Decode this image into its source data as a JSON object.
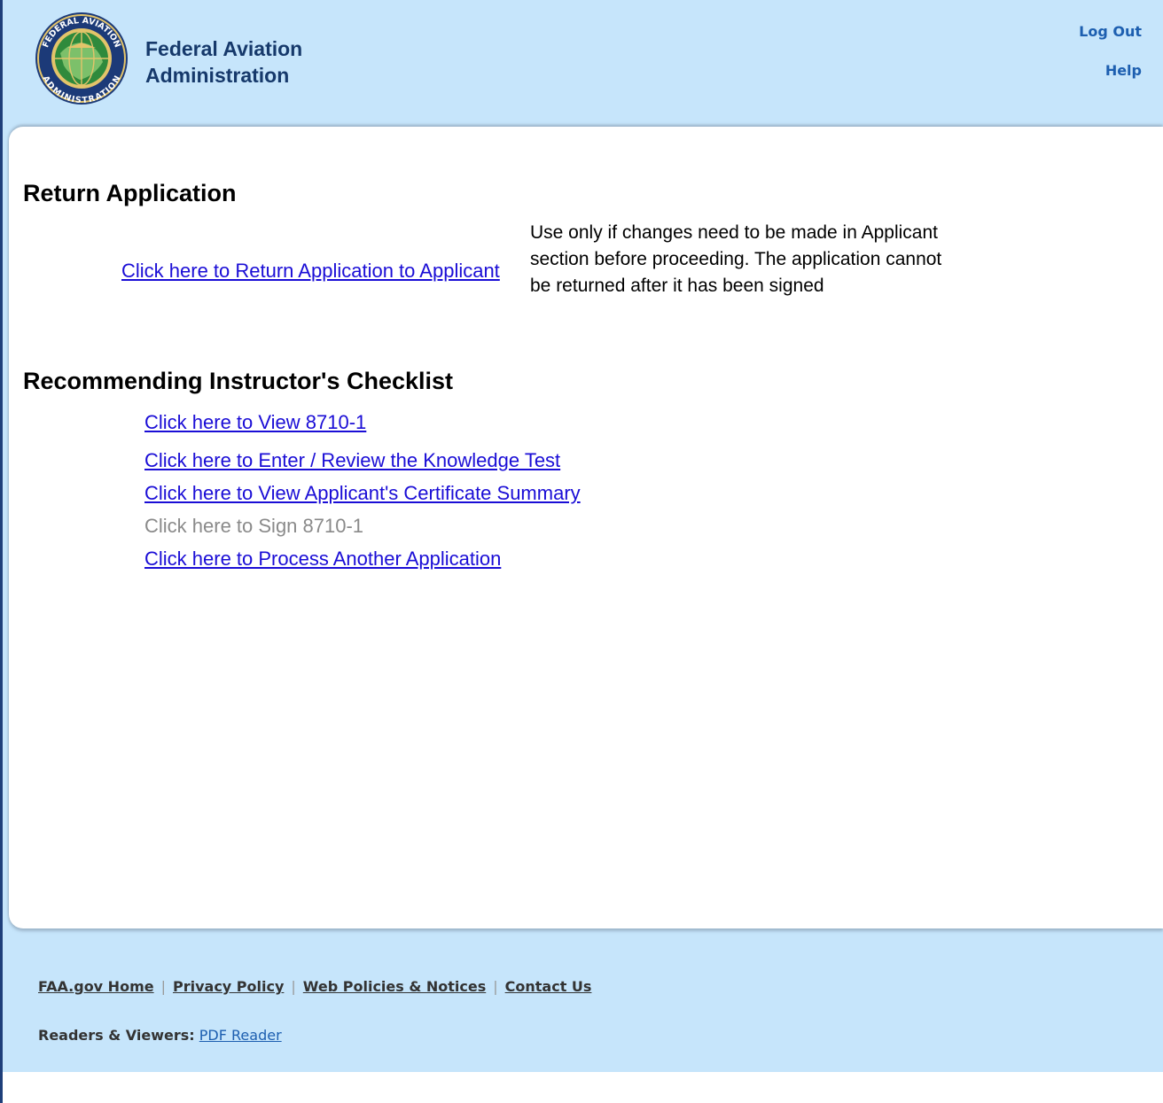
{
  "header": {
    "seal_text": "FEDERAL AVIATION ADMINISTRATION",
    "agency_line1": "Federal Aviation",
    "agency_line2": "Administration",
    "logout": "Log Out",
    "help": "Help",
    "colors": {
      "header_bg": "#c6e5fb",
      "link_blue": "#1d5fb0",
      "title_navy": "#16396b"
    }
  },
  "return_section": {
    "heading": "Return Application",
    "link": "Click here to Return Application to Applicant",
    "note": "Use only if changes need to be made in Applicant section before proceeding. The application cannot be returned after it has been signed"
  },
  "checklist": {
    "heading": "Recommending Instructor's Checklist",
    "items": [
      {
        "label": "Click here to View 8710-1",
        "enabled": true
      },
      {
        "label": "Click here to Enter / Review the Knowledge Test",
        "enabled": true
      },
      {
        "label": "Click here to View Applicant's Certificate Summary",
        "enabled": true
      },
      {
        "label": "Click here to Sign 8710-1",
        "enabled": false
      },
      {
        "label": "Click here to Process Another Application",
        "enabled": true
      }
    ]
  },
  "footer": {
    "links": [
      "FAA.gov Home",
      "Privacy Policy",
      "Web Policies & Notices",
      "Contact Us"
    ],
    "readers_label": "Readers & Viewers:",
    "readers_link": "PDF Reader"
  }
}
